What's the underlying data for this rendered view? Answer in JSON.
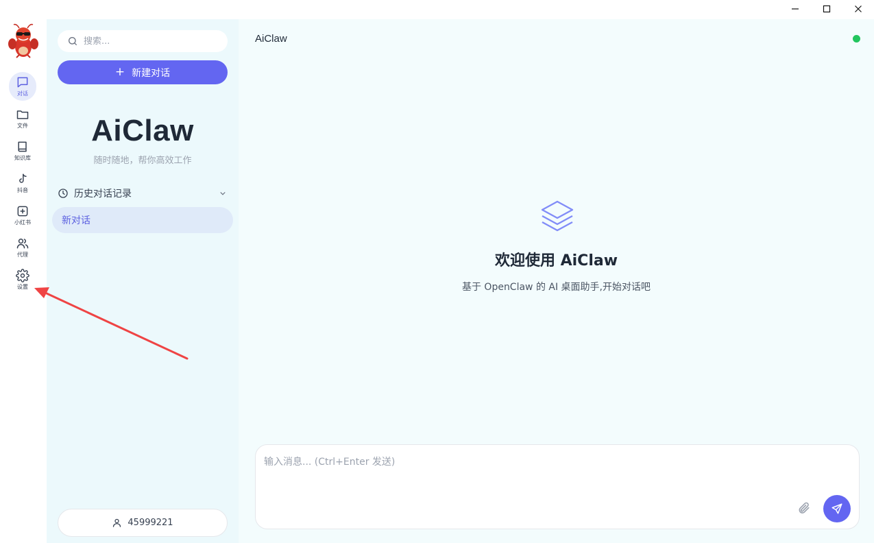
{
  "window": {
    "controls": [
      "minimize-icon",
      "maximize-icon",
      "close-icon"
    ]
  },
  "rail": {
    "items": [
      {
        "label": "对话",
        "icon": "chat-bubble-icon",
        "active": true
      },
      {
        "label": "文件",
        "icon": "folder-icon",
        "active": false
      },
      {
        "label": "知识库",
        "icon": "book-icon",
        "active": false
      },
      {
        "label": "抖音",
        "icon": "tiktok-icon",
        "active": false
      },
      {
        "label": "小红书",
        "icon": "plus-square-icon",
        "active": false
      },
      {
        "label": "代理",
        "icon": "users-icon",
        "active": false
      },
      {
        "label": "设置",
        "icon": "gear-icon",
        "active": false
      }
    ]
  },
  "sidebar": {
    "search_placeholder": "搜索...",
    "new_chat_label": "新建对话",
    "brand": "AiClaw",
    "tagline": "随时随地，帮你高效工作",
    "history_title": "历史对话记录",
    "conversations": [
      "新对话"
    ],
    "user_id": "45999221"
  },
  "main": {
    "title": "AiClaw",
    "welcome_title": "欢迎使用 AiClaw",
    "welcome_subtitle": "基于 OpenClaw 的 AI 桌面助手,开始对话吧",
    "input_placeholder": "输入消息... (Ctrl+Enter 发送)"
  },
  "colors": {
    "accent": "#6366f1",
    "sidebar_bg": "#ecf9fc",
    "main_bg": "#f3fcfd",
    "status_online": "#22c55e",
    "annotation_arrow": "#ef4444"
  }
}
